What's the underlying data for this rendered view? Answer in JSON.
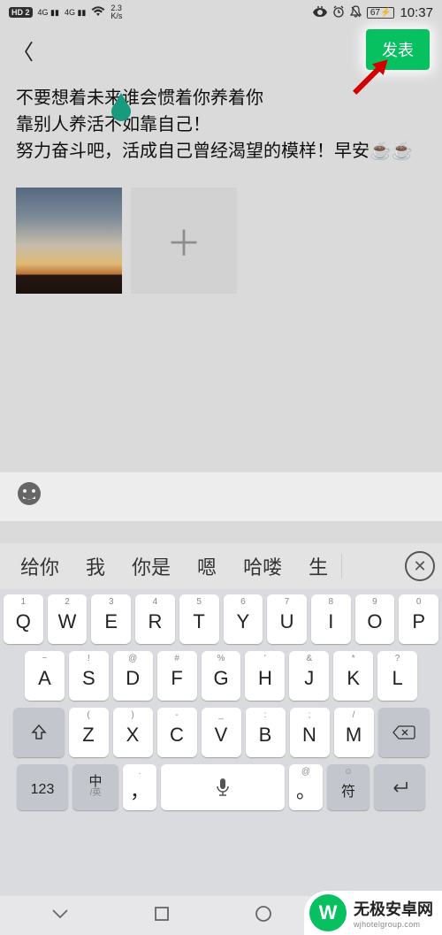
{
  "status": {
    "hd": "HD 2",
    "sig1": "4G",
    "sig2": "4G",
    "speed_top": "2.3",
    "speed_bot": "K/s",
    "battery": "67",
    "time": "10:37"
  },
  "topbar": {
    "publish_label": "发表"
  },
  "post": {
    "text": "不要想着未来谁会惯着你养着你\n靠别人养活不如靠自己！\n努力奋斗吧，活成自己曾经渴望的模样！早安☕☕"
  },
  "suggestions": {
    "items": [
      "给你",
      "我",
      "你是",
      "嗯",
      "哈喽",
      "生"
    ]
  },
  "keyboard": {
    "row1_tops": [
      "1",
      "2",
      "3",
      "4",
      "5",
      "6",
      "7",
      "8",
      "9",
      "0"
    ],
    "row1_main": [
      "Q",
      "W",
      "E",
      "R",
      "T",
      "Y",
      "U",
      "I",
      "O",
      "P"
    ],
    "row2_tops": [
      "~",
      "!",
      "@",
      "#",
      "%",
      "'",
      "&",
      "*",
      "?"
    ],
    "row2_main": [
      "A",
      "S",
      "D",
      "F",
      "G",
      "H",
      "J",
      "K",
      "L"
    ],
    "row3_tops": [
      "(",
      ")",
      "-",
      "_",
      ":",
      ";",
      "/"
    ],
    "row3_main": [
      "Z",
      "X",
      "C",
      "V",
      "B",
      "N",
      "M"
    ],
    "key123": "123",
    "lang_top": "中",
    "lang_bot": "/英",
    "comma_top": ".",
    "comma": "，",
    "period_top": "@",
    "period": "。",
    "sym_top": "☺",
    "sym": "符"
  },
  "watermark": {
    "logo": "W",
    "title": "无极安卓网",
    "sub": "wjhotelgroup.com"
  }
}
